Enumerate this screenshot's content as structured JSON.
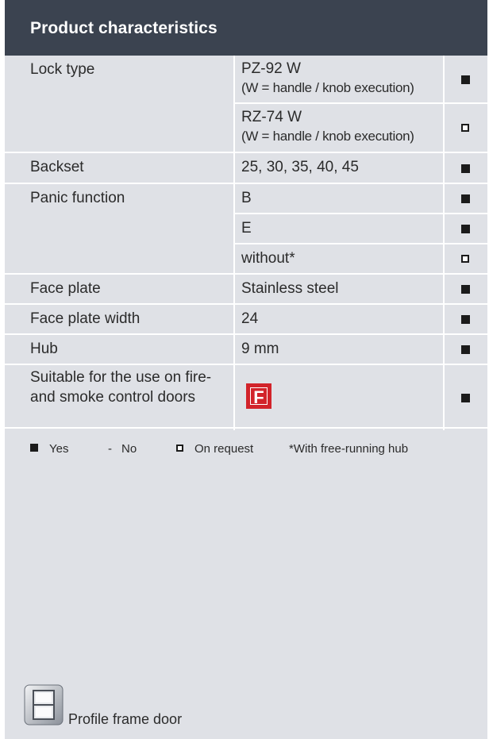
{
  "header": {
    "title": "Product characteristics"
  },
  "rows": [
    {
      "label": "Lock type",
      "values": [
        {
          "line1": "PZ-92 W",
          "line2": "(W = handle / knob execution)",
          "availability": "on-request-filled"
        },
        {
          "line1": "RZ-74 W",
          "line2": "(W = handle / knob execution)",
          "availability": "on-request"
        }
      ]
    },
    {
      "label": "Backset",
      "values": [
        {
          "line1": "25, 30, 35, 40, 45",
          "availability": "yes"
        }
      ]
    },
    {
      "label": "Panic function",
      "values": [
        {
          "line1": "B",
          "availability": "yes"
        },
        {
          "line1": "E",
          "availability": "yes"
        },
        {
          "line1": "without*",
          "availability": "on-request"
        }
      ]
    },
    {
      "label": "Face plate",
      "values": [
        {
          "line1": "Stainless steel",
          "availability": "yes"
        }
      ]
    },
    {
      "label": "Face plate width",
      "values": [
        {
          "line1": "24",
          "availability": "yes"
        }
      ]
    },
    {
      "label": "Hub",
      "values": [
        {
          "line1": "9 mm",
          "availability": "yes"
        }
      ]
    },
    {
      "label": "Suitable for the use on fire- and smoke control doors",
      "values": [
        {
          "badge": "F",
          "availability": "yes"
        }
      ]
    }
  ],
  "legend": {
    "yes": "Yes",
    "no_symbol": "-",
    "no": "No",
    "on_request": "On request",
    "note": "*With free-running hub"
  },
  "footer": {
    "door_label": "Profile frame door",
    "door_icon": "profile-frame-door-icon"
  },
  "colors": {
    "header_bg": "#3b4350",
    "panel_bg": "#dfe1e6",
    "badge_red": "#d2232a"
  }
}
